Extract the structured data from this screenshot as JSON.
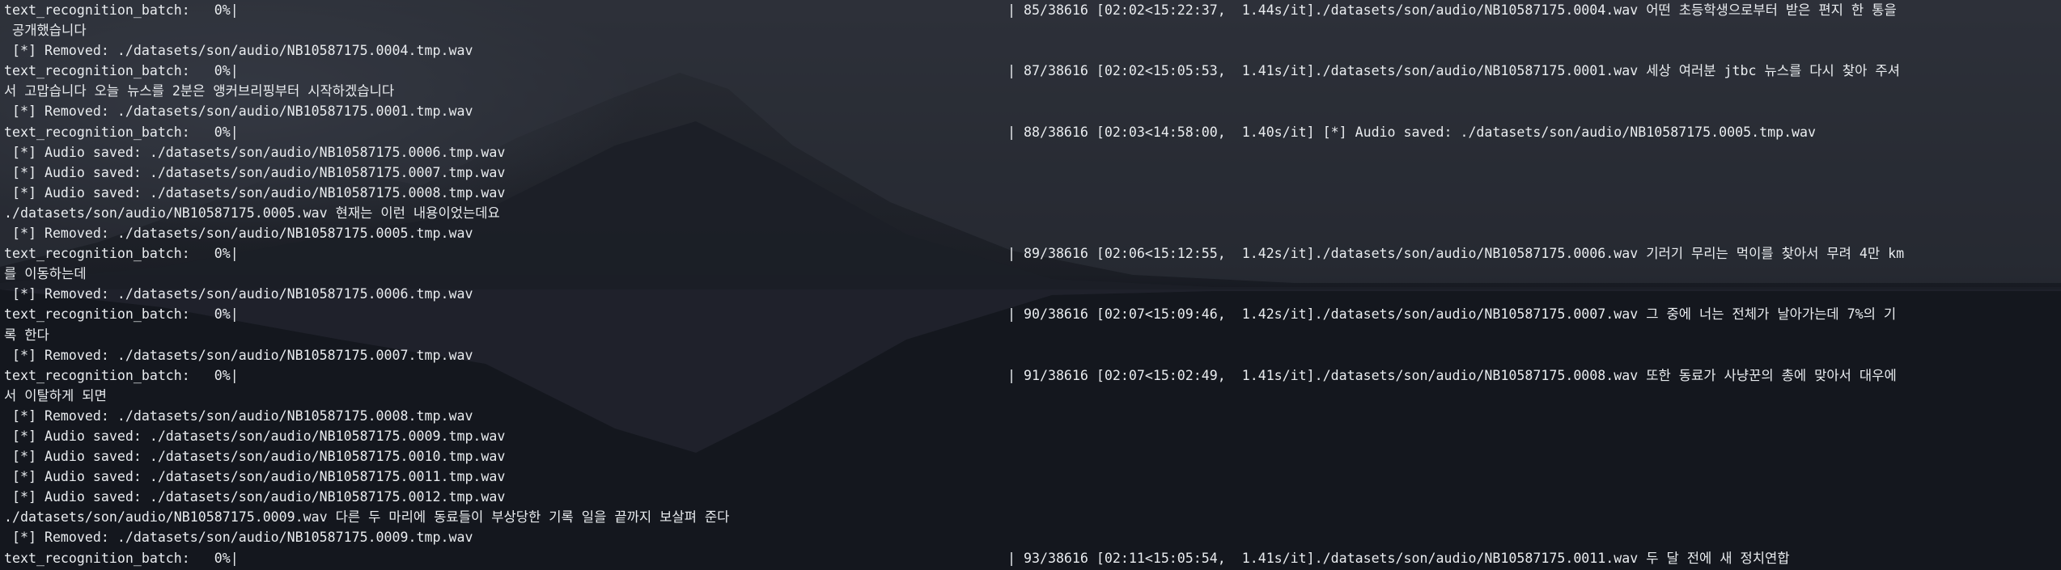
{
  "terminal": {
    "lines": [
      {
        "left": "text_recognition_batch:   0%|",
        "right": "| 85/38616 [02:02<15:22:37,  1.44s/it]./datasets/son/audio/NB10587175.0004.wav 어떤 초등학생으로부터 받은 편지 한 통을"
      },
      {
        "left": " 공개했습니다",
        "right": ""
      },
      {
        "left": " [*] Removed: ./datasets/son/audio/NB10587175.0004.tmp.wav",
        "right": ""
      },
      {
        "left": "text_recognition_batch:   0%|",
        "right": "| 87/38616 [02:02<15:05:53,  1.41s/it]./datasets/son/audio/NB10587175.0001.wav 세상 여러분 jtbc 뉴스를 다시 찾아 주셔"
      },
      {
        "left": "서 고맙습니다 오늘 뉴스를 2분은 앵커브리핑부터 시작하겠습니다",
        "right": ""
      },
      {
        "left": " [*] Removed: ./datasets/son/audio/NB10587175.0001.tmp.wav",
        "right": ""
      },
      {
        "left": "text_recognition_batch:   0%|",
        "right": "| 88/38616 [02:03<14:58:00,  1.40s/it] [*] Audio saved: ./datasets/son/audio/NB10587175.0005.tmp.wav"
      },
      {
        "left": " [*] Audio saved: ./datasets/son/audio/NB10587175.0006.tmp.wav",
        "right": ""
      },
      {
        "left": " [*] Audio saved: ./datasets/son/audio/NB10587175.0007.tmp.wav",
        "right": ""
      },
      {
        "left": " [*] Audio saved: ./datasets/son/audio/NB10587175.0008.tmp.wav",
        "right": ""
      },
      {
        "left": "./datasets/son/audio/NB10587175.0005.wav 현재는 이런 내용이었는데요",
        "right": ""
      },
      {
        "left": " [*] Removed: ./datasets/son/audio/NB10587175.0005.tmp.wav",
        "right": ""
      },
      {
        "left": "text_recognition_batch:   0%|",
        "right": "| 89/38616 [02:06<15:12:55,  1.42s/it]./datasets/son/audio/NB10587175.0006.wav 기러기 무리는 먹이를 찾아서 무려 4만 km"
      },
      {
        "left": "를 이동하는데",
        "right": ""
      },
      {
        "left": " [*] Removed: ./datasets/son/audio/NB10587175.0006.tmp.wav",
        "right": ""
      },
      {
        "left": "text_recognition_batch:   0%|",
        "right": "| 90/38616 [02:07<15:09:46,  1.42s/it]./datasets/son/audio/NB10587175.0007.wav 그 중에 너는 전체가 날아가는데 7%의 기"
      },
      {
        "left": "록 한다",
        "right": ""
      },
      {
        "left": " [*] Removed: ./datasets/son/audio/NB10587175.0007.tmp.wav",
        "right": ""
      },
      {
        "left": "text_recognition_batch:   0%|",
        "right": "| 91/38616 [02:07<15:02:49,  1.41s/it]./datasets/son/audio/NB10587175.0008.wav 또한 동료가 사냥꾼의 총에 맞아서 대우에"
      },
      {
        "left": "서 이탈하게 되면",
        "right": ""
      },
      {
        "left": " [*] Removed: ./datasets/son/audio/NB10587175.0008.tmp.wav",
        "right": ""
      },
      {
        "left": " [*] Audio saved: ./datasets/son/audio/NB10587175.0009.tmp.wav",
        "right": ""
      },
      {
        "left": " [*] Audio saved: ./datasets/son/audio/NB10587175.0010.tmp.wav",
        "right": ""
      },
      {
        "left": " [*] Audio saved: ./datasets/son/audio/NB10587175.0011.tmp.wav",
        "right": ""
      },
      {
        "left": " [*] Audio saved: ./datasets/son/audio/NB10587175.0012.tmp.wav",
        "right": ""
      },
      {
        "left": "./datasets/son/audio/NB10587175.0009.wav 다른 두 마리에 동료들이 부상당한 기록 일을 끝까지 보살펴 준다",
        "right": ""
      },
      {
        "left": " [*] Removed: ./datasets/son/audio/NB10587175.0009.tmp.wav",
        "right": ""
      },
      {
        "left": "text_recognition_batch:   0%|",
        "right": "| 93/38616 [02:11<15:05:54,  1.41s/it]./datasets/son/audio/NB10587175.0011.wav 두 달 전에 새 정치연합"
      }
    ]
  },
  "colors": {
    "text": "#e9ecef",
    "background": "#0d1118"
  }
}
